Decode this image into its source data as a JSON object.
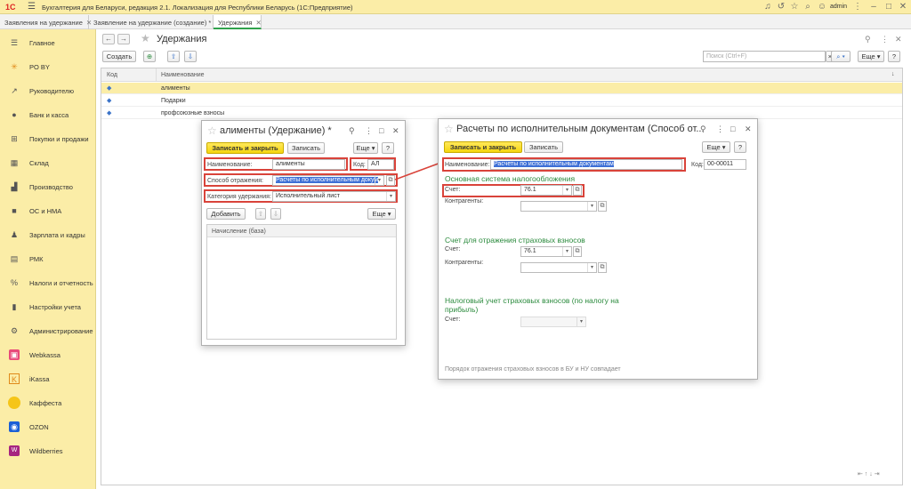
{
  "app": {
    "logo": "1С",
    "title": "Бухгалтерия для Беларуси, редакция 2.1. Локализация для Республики Беларусь  (1С:Предприятие)",
    "user": "admin"
  },
  "tabs": [
    {
      "label": "Заявления на удержание"
    },
    {
      "label": "Заявление на удержание (создание) *"
    },
    {
      "label": "Удержания"
    }
  ],
  "sidebar": {
    "items": [
      {
        "label": "Главное",
        "icon": "menu-icon"
      },
      {
        "label": "PO BY",
        "icon": "sun-icon"
      },
      {
        "label": "Руководителю",
        "icon": "chart-icon"
      },
      {
        "label": "Банк и касса",
        "icon": "bank-icon"
      },
      {
        "label": "Покупки и продажи",
        "icon": "cart-icon"
      },
      {
        "label": "Склад",
        "icon": "warehouse-icon"
      },
      {
        "label": "Производство",
        "icon": "factory-icon"
      },
      {
        "label": "ОС и НМА",
        "icon": "truck-icon"
      },
      {
        "label": "Зарплата и кадры",
        "icon": "person-icon"
      },
      {
        "label": "РМК",
        "icon": "register-icon"
      },
      {
        "label": "Налоги и отчетность",
        "icon": "tax-icon"
      },
      {
        "label": "Настройки учета",
        "icon": "book-icon"
      },
      {
        "label": "Администрирование",
        "icon": "gear-icon"
      },
      {
        "label": "Webkassa",
        "icon": "webkassa-icon"
      },
      {
        "label": "iKassa",
        "icon": "ikassa-icon"
      },
      {
        "label": "Каффеста",
        "icon": "kaffesta-icon"
      },
      {
        "label": "OZON",
        "icon": "ozon-icon"
      },
      {
        "label": "Wildberries",
        "icon": "wildberries-icon"
      }
    ]
  },
  "main": {
    "title": "Удержания",
    "create_label": "Создать",
    "search_placeholder": "Поиск (Ctrl+F)",
    "more_label": "Еще",
    "columns": {
      "code": "Код",
      "name": "Наименование"
    },
    "rows": [
      {
        "name": "алименты"
      },
      {
        "name": "Подарки"
      },
      {
        "name": "профсоюзные взносы"
      }
    ]
  },
  "dialog1": {
    "title": "алименты (Удержание) *",
    "save_close": "Записать и закрыть",
    "save": "Записать",
    "more": "Еще",
    "help": "?",
    "name_label": "Наименование:",
    "name_value": "алименты",
    "code_label": "Код:",
    "code_value": "АЛ",
    "method_label": "Способ отражения:",
    "method_value": "Расчеты по исполнительным докум",
    "category_label": "Категория удержания:",
    "category_value": "Исполнительный лист",
    "add_label": "Добавить",
    "more2": "Еще",
    "table_header": "Начисление (база)"
  },
  "dialog2": {
    "title": "Расчеты по исполнительным документам (Способ от...",
    "save_close": "Записать и закрыть",
    "save": "Записать",
    "more": "Еще",
    "help": "?",
    "name_label": "Наименование:",
    "name_value": "Расчеты по исполнительным документам",
    "code_label": "Код:",
    "code_value": "00-00011",
    "section1": "Основная система налогообложения",
    "account_label": "Счет:",
    "account_value1": "76.1",
    "contractors_label": "Контрагенты:",
    "section2": "Счет для отражения страховых взносов",
    "account_value2": "76.1",
    "section3_line1": "Налоговый учет страховых взносов (по налогу на",
    "section3_line2": "прибыль)",
    "footer": "Порядок отражения страховых взносов в БУ и НУ совпадает"
  }
}
